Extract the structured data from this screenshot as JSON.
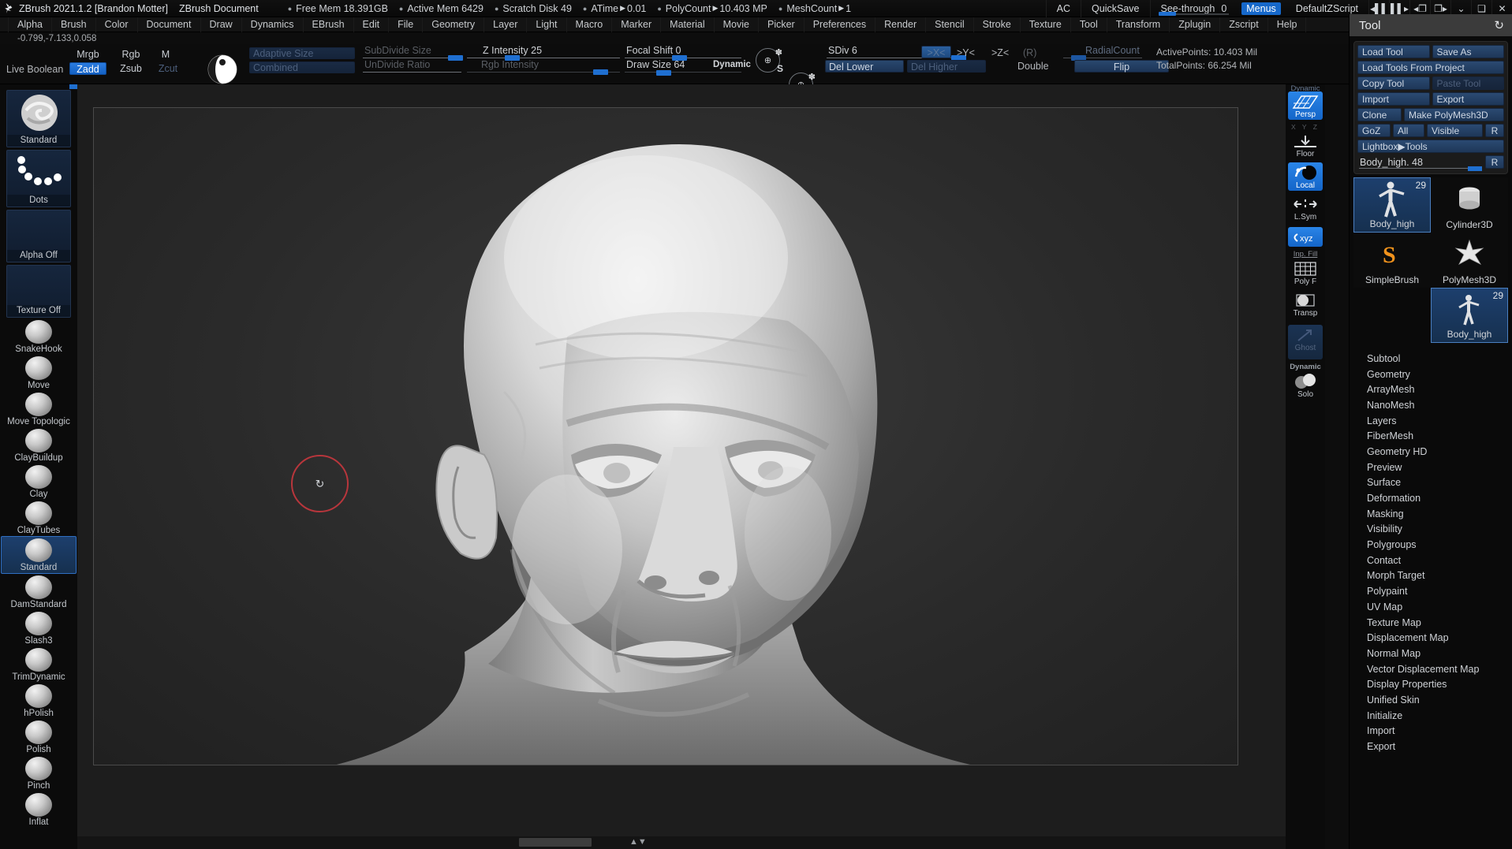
{
  "titlebar": {
    "logo_icon": "zbrush-logo-icon",
    "app_title": "ZBrush 2021.1.2 [Brandon Motter]",
    "document_title": "ZBrush Document",
    "stats": [
      {
        "label": "Free Mem",
        "value": "18.391GB",
        "arrow": false
      },
      {
        "label": "Active Mem",
        "value": "6429",
        "arrow": false
      },
      {
        "label": "Scratch Disk",
        "value": "49",
        "arrow": false
      },
      {
        "label": "ATime",
        "value": "0.01",
        "arrow": true
      },
      {
        "label": "PolyCount",
        "value": "10.403 MP",
        "arrow": true
      },
      {
        "label": "MeshCount",
        "value": "1",
        "arrow": true
      }
    ],
    "ac_label": "AC",
    "quicksave_label": "QuickSave",
    "see_through_label": "See-through",
    "see_through_value": "0",
    "menus_label": "Menus",
    "zscript_label": "DefaultZScript",
    "icons": [
      "prev-tray-icon",
      "next-tray-icon",
      "left-tray-icon",
      "right-tray-icon",
      "minimize-icon",
      "restore-icon",
      "close-icon"
    ]
  },
  "menubar": {
    "items": [
      "Alpha",
      "Brush",
      "Color",
      "Document",
      "Draw",
      "Dynamics",
      "EBrush",
      "Edit",
      "File",
      "Geometry",
      "Layer",
      "Light",
      "Macro",
      "Marker",
      "Material",
      "Movie",
      "Picker",
      "Preferences",
      "Render",
      "Stencil",
      "Stroke",
      "Texture",
      "Tool",
      "Transform",
      "Zplugin",
      "Zscript",
      "Help"
    ]
  },
  "coords": "-0.799,-7.133,0.058",
  "toolbar": {
    "live_boolean": "Live Boolean",
    "mrgb": "Mrgb",
    "rgb": "Rgb",
    "m": "M",
    "zadd": "Zadd",
    "zsub": "Zsub",
    "zcut": "Zcut",
    "material_icon": "material-sphere-icon",
    "adaptive_size": "Adaptive Size",
    "combined": "Combined",
    "subdivide_size": "SubDivide Size",
    "undivide_ratio": "UnDivide Ratio",
    "z_intensity": "Z Intensity 25",
    "rgb_intensity": "Rgb Intensity",
    "focal_shift": "Focal Shift 0",
    "draw_size": "Draw Size  64",
    "dynamic": "Dynamic",
    "s_button_icon": "dynamic-size-s-icon",
    "d_button_icon": "dynamic-draw-d-icon",
    "sdiv": "SDiv 6",
    "del_lower": "Del Lower",
    "del_higher": "Del Higher",
    "sym_x": ">X<",
    "sym_y": ">Y<",
    "sym_z": ">Z<",
    "sym_r": "(R)",
    "double": "Double",
    "radial_count": "RadialCount",
    "flip": "Flip",
    "active_points": "ActivePoints: 10.403 Mil",
    "total_points": "TotalPoints: 66.254 Mil"
  },
  "leftbar": {
    "tiles": [
      {
        "name": "Standard",
        "icon": "brush-standard-thumb",
        "selected": false
      },
      {
        "name": "Dots",
        "icon": "stroke-dots-thumb",
        "selected": false
      },
      {
        "name": "Alpha Off",
        "icon": "alpha-off-thumb",
        "selected": false
      },
      {
        "name": "Texture Off",
        "icon": "texture-off-thumb",
        "selected": false
      }
    ],
    "brushes": [
      {
        "name": "SnakeHook",
        "selected": false
      },
      {
        "name": "Move",
        "selected": false
      },
      {
        "name": "Move Topologic",
        "selected": false
      },
      {
        "name": "ClayBuildup",
        "selected": false
      },
      {
        "name": "Clay",
        "selected": false
      },
      {
        "name": "ClayTubes",
        "selected": false
      },
      {
        "name": "Standard",
        "selected": true
      },
      {
        "name": "DamStandard",
        "selected": false
      },
      {
        "name": "Slash3",
        "selected": false
      },
      {
        "name": "TrimDynamic",
        "selected": false
      },
      {
        "name": "hPolish",
        "selected": false
      },
      {
        "name": "Polish",
        "selected": false
      },
      {
        "name": "Pinch",
        "selected": false
      },
      {
        "name": "Inflat",
        "selected": false
      }
    ]
  },
  "canvas": {
    "cursor_icon": "brush-cursor-ring",
    "rotate_icon": "rotate-icon",
    "model_description": "3D sculpted human head bust"
  },
  "rightstrip": {
    "items": [
      {
        "label": "Persp",
        "icon": "perspective-icon",
        "state": "on"
      },
      {
        "label": "Floor",
        "icon": "floor-grid-icon",
        "state": "off"
      },
      {
        "label": "Local",
        "icon": "local-symmetry-icon",
        "state": "on"
      },
      {
        "label": "L.Sym",
        "icon": "local-sym-arrows-icon",
        "state": "off"
      },
      {
        "label": "Xyz",
        "icon": "xyz-axis-icon",
        "state": "on"
      },
      {
        "label": "Poly F",
        "icon": "polyframe-icon",
        "state": "off"
      },
      {
        "label": "Transp",
        "icon": "transparency-icon",
        "state": "off"
      },
      {
        "label": "Ghost",
        "icon": "ghost-icon",
        "state": "dim"
      },
      {
        "label": "Solo",
        "icon": "solo-icon",
        "state": "off"
      }
    ],
    "top_label": "Dynamic",
    "xyz_small": "X Y Z",
    "fill_label": "Inp. Fill",
    "dynamic_label": "Dynamic"
  },
  "toolpanel": {
    "title": "Tool",
    "refresh_icon": "refresh-icon",
    "rows": [
      [
        {
          "label": "Load Tool",
          "state": "normal"
        },
        {
          "label": "Save As",
          "state": "normal"
        }
      ],
      [
        {
          "label": "Load Tools From Project",
          "state": "normal"
        }
      ],
      [
        {
          "label": "Copy Tool",
          "state": "normal"
        },
        {
          "label": "Paste Tool",
          "state": "dim"
        }
      ],
      [
        {
          "label": "Import",
          "state": "normal"
        },
        {
          "label": "Export",
          "state": "normal"
        }
      ],
      [
        {
          "label": "Clone",
          "state": "normal"
        },
        {
          "label": "Make PolyMesh3D",
          "state": "normal"
        }
      ],
      [
        {
          "label": "GoZ",
          "state": "normal"
        },
        {
          "label": "All",
          "state": "normal"
        },
        {
          "label": "Visible",
          "state": "normal"
        },
        {
          "label": "R",
          "state": "normal"
        }
      ],
      [
        {
          "label": "Lightbox▶Tools",
          "state": "normal"
        }
      ]
    ],
    "name_slider": {
      "label": "Body_high. 48",
      "r_label": "R"
    },
    "thumbs": [
      {
        "label": "Body_high",
        "badge": "29",
        "selected": true,
        "icon": "body-figure-icon"
      },
      {
        "label": "Cylinder3D",
        "badge": "",
        "selected": false,
        "icon": "cylinder3d-icon"
      },
      {
        "label": "PolyMesh3D",
        "badge": "",
        "selected": false,
        "icon": "polymesh3d-star-icon"
      },
      {
        "label": "SimpleBrush",
        "badge": "",
        "selected": false,
        "icon": "simplebrush-s-icon"
      },
      {
        "label": "Body_high",
        "badge": "29",
        "selected": true,
        "icon": "body-figure-icon"
      }
    ],
    "subpalettes": [
      "Subtool",
      "Geometry",
      "ArrayMesh",
      "NanoMesh",
      "Layers",
      "FiberMesh",
      "Geometry HD",
      "Preview",
      "Surface",
      "Deformation",
      "Masking",
      "Visibility",
      "Polygroups",
      "Contact",
      "Morph Target",
      "Polypaint",
      "UV Map",
      "Texture Map",
      "Displacement Map",
      "Normal Map",
      "Vector Displacement Map",
      "Display Properties",
      "Unified Skin",
      "Initialize",
      "Import",
      "Export"
    ]
  },
  "colors": {
    "accent_blue": "#1f6fd0",
    "panel_dark": "#0a0a0a",
    "canvas_gray": "#1d1d1d",
    "cursor_red": "#b8363c",
    "btn_blue": "#2b4a72"
  }
}
